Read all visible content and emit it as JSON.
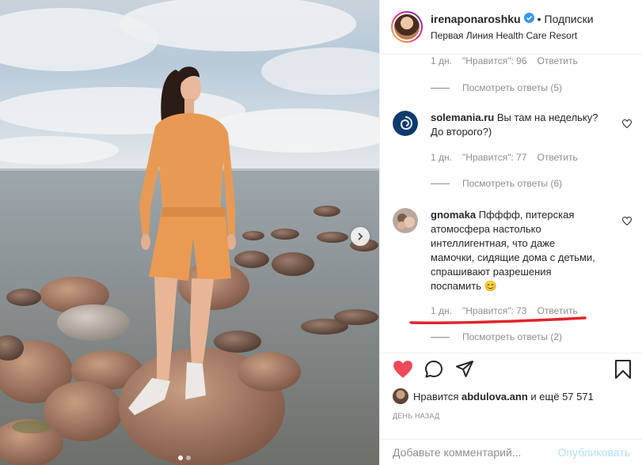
{
  "header": {
    "username": "irenaponaroshku",
    "separator": "•",
    "follow_label": "Подписки",
    "location": "Первая Линия Health Care Resort"
  },
  "comments": {
    "top_meta": {
      "time": "1 дн.",
      "likes": "\"Нравится\": 96",
      "reply": "Ответить"
    },
    "top_view_replies": "Посмотреть ответы (5)",
    "items": [
      {
        "username": "solemania.ru",
        "text": "Вы там на недельку? До второго?)",
        "time": "1 дн.",
        "likes": "\"Нравится\": 77",
        "reply": "Ответить",
        "view_replies": "Посмотреть ответы (6)"
      },
      {
        "username": "gnomaka",
        "text": "Пфффф, питерская атомосфера настолько интеллигентная, что даже мамочки, сидящие дома с детьми, спрашивают разрешения поспамить 😊",
        "time": "1 дн.",
        "likes": "\"Нравится\": 73",
        "reply": "Ответить",
        "view_replies": "Посмотреть ответы (2)"
      }
    ]
  },
  "likes": {
    "prefix": "Нравится",
    "user": "abdulova.ann",
    "suffix": "и ещё 57 571"
  },
  "date": "ДЕНЬ НАЗАД",
  "add_comment": {
    "placeholder": "Добавьте комментарий...",
    "publish": "Опубликовать"
  },
  "icons": {
    "like": "heart-filled-icon",
    "comment": "speech-bubble-icon",
    "share": "paper-plane-icon",
    "save": "bookmark-icon",
    "verified": "verified-badge-icon",
    "next": "chevron-right-icon"
  },
  "colors": {
    "like_red": "#ed4956",
    "verified_blue": "#3897f0",
    "publish_disabled": "#b2dffc",
    "annotation_red": "#e0242b"
  },
  "carousel": {
    "slides": 2,
    "current": 1
  }
}
